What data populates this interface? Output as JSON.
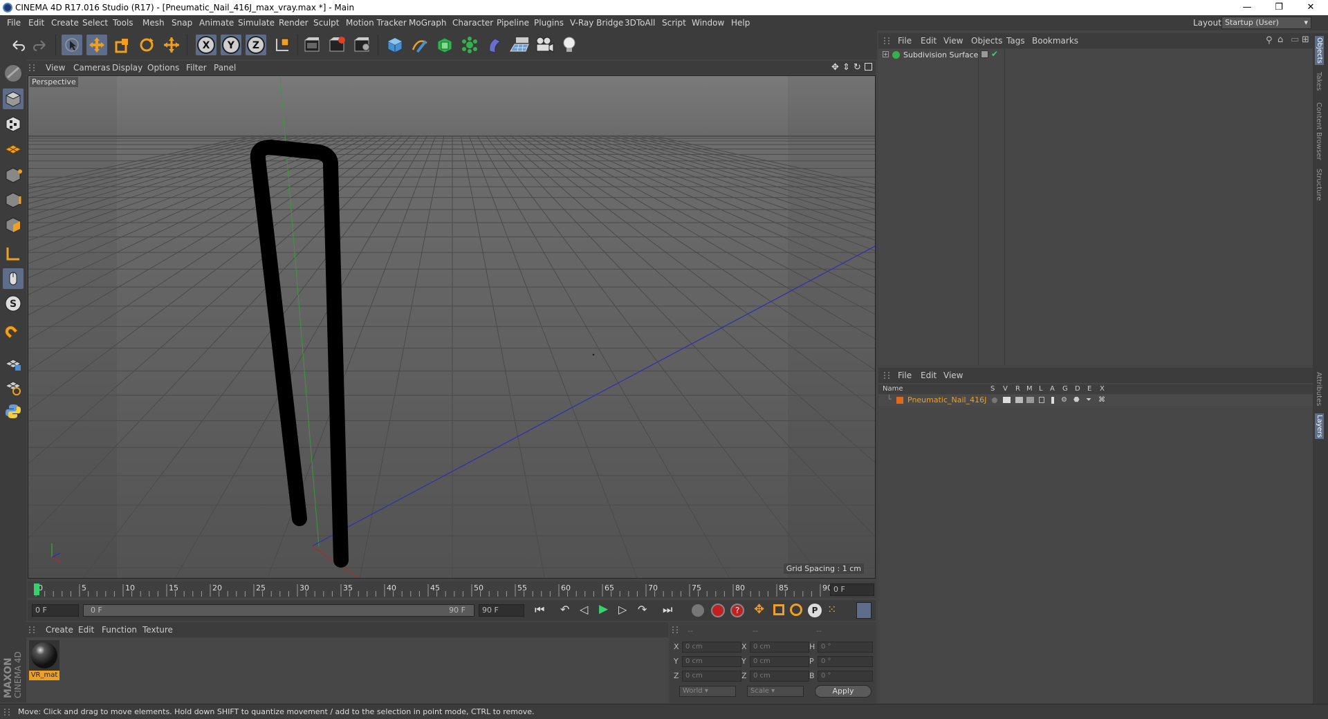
{
  "window": {
    "title": "CINEMA 4D R17.016 Studio (R17) - [Pneumatic_Nail_416J_max_vray.max *] - Main",
    "minimize": "—",
    "maximize": "❐",
    "close": "✕"
  },
  "menubar": {
    "items": [
      "File",
      "Edit",
      "Create",
      "Select",
      "Tools",
      "Mesh",
      "Snap",
      "Animate",
      "Simulate",
      "Render",
      "Sculpt",
      "Motion Tracker",
      "MoGraph",
      "Character",
      "Pipeline",
      "Plugins",
      "V-Ray Bridge",
      "3DToAll",
      "Script",
      "Window",
      "Help"
    ],
    "layout_label": "Layout:",
    "layout_value": "Startup (User)"
  },
  "toolbar": {
    "axis_x": "X",
    "axis_y": "Y",
    "axis_z": "Z"
  },
  "viewport": {
    "menu": [
      "View",
      "Cameras",
      "Display",
      "Options",
      "Filter",
      "Panel"
    ],
    "label": "Perspective",
    "grid_spacing": "Grid Spacing : 1 cm"
  },
  "timeline": {
    "ticks": [
      "0",
      "5",
      "10",
      "15",
      "20",
      "25",
      "30",
      "35",
      "40",
      "45",
      "50",
      "55",
      "60",
      "65",
      "70",
      "75",
      "80",
      "85",
      "90"
    ],
    "end_field": "0 F",
    "current_frame": "0 F",
    "range_start": "0 F",
    "range_end": "90 F",
    "max_frame": "90 F"
  },
  "materials": {
    "menu": [
      "Create",
      "Edit",
      "Function",
      "Texture"
    ],
    "items": [
      {
        "name": "VR_mat"
      }
    ]
  },
  "coordinates": {
    "header": [
      "--",
      "--",
      "--"
    ],
    "rows": [
      {
        "a": "X",
        "a_val": "0 cm",
        "b": "X",
        "b_val": "0 cm",
        "c": "H",
        "c_val": "0 °"
      },
      {
        "a": "Y",
        "a_val": "0 cm",
        "b": "Y",
        "b_val": "0 cm",
        "c": "P",
        "c_val": "0 °"
      },
      {
        "a": "Z",
        "a_val": "0 cm",
        "b": "Z",
        "b_val": "0 cm",
        "c": "B",
        "c_val": "0 °"
      }
    ],
    "mode1": "World",
    "mode2": "Scale",
    "apply": "Apply"
  },
  "objects": {
    "menu": [
      "File",
      "Edit",
      "View",
      "Objects",
      "Tags",
      "Bookmarks"
    ],
    "items": [
      {
        "name": "Subdivision Surface"
      }
    ]
  },
  "layers": {
    "menu": [
      "File",
      "Edit",
      "View"
    ],
    "columns": [
      "Name",
      "S",
      "V",
      "R",
      "M",
      "L",
      "A",
      "G",
      "D",
      "E",
      "X"
    ],
    "items": [
      {
        "name": "Pneumatic_Nail_416J",
        "color": "#e06a1c"
      }
    ]
  },
  "right_tabs": [
    "Objects",
    "Takes",
    "Content Browser",
    "Structure",
    "Attributes",
    "Layers"
  ],
  "status": "Move: Click and drag to move elements. Hold down SHIFT to quantize movement / add to the selection in point mode, CTRL to remove.",
  "brand": {
    "line1": "MAXON",
    "line2": "CINEMA 4D"
  },
  "colors": {
    "accent": "#5d6d8a",
    "layer_name": "#e8a030",
    "nail": "#000000"
  }
}
